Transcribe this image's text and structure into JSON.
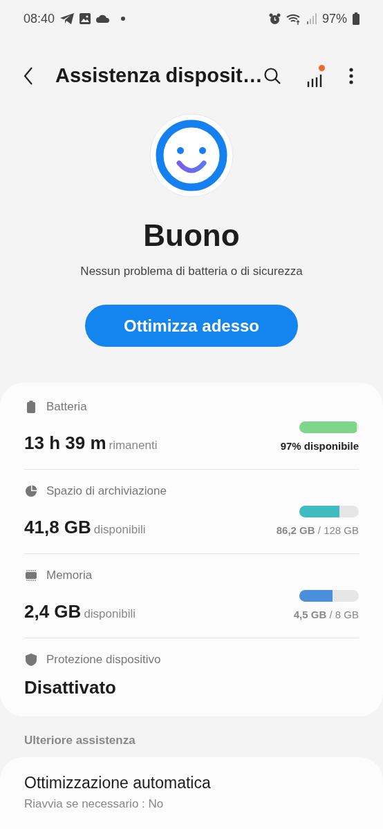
{
  "status_bar": {
    "time": "08:40",
    "battery": "97%"
  },
  "header": {
    "title": "Assistenza disposit…",
    "notification_dot": true
  },
  "status": {
    "title": "Buono",
    "subtitle": "Nessun problema di batteria o di sicurezza",
    "button": "Ottimizza adesso"
  },
  "items": [
    {
      "kind": "battery",
      "label": "Batteria",
      "value": "13 h 39 m",
      "unit": "rimanenti",
      "level": 0.97,
      "color": "#7dd68a",
      "reading": "97% disponibile",
      "reading_bold": true
    },
    {
      "kind": "storage",
      "label": "Spazio di archiviazione",
      "value": "41,8 GB",
      "unit": "disponibili",
      "level": 0.67,
      "color": "#3fbcc0",
      "reading": "**86,2 GB** / 128 GB",
      "reading_bold": false
    },
    {
      "kind": "memory",
      "label": "Memoria",
      "value": "2,4 GB",
      "unit": "disponibili",
      "level": 0.56,
      "color": "#4a8fdc",
      "reading": "**4,5 GB** / 8 GB",
      "reading_bold": false
    },
    {
      "kind": "protection",
      "label": "Protezione dispositivo",
      "value": "Disattivato"
    }
  ],
  "more": {
    "heading": "Ulteriore assistenza",
    "items": [
      {
        "title": "Ottimizzazione automatica",
        "subtitle": "Riavvia se necessario : No"
      }
    ]
  }
}
